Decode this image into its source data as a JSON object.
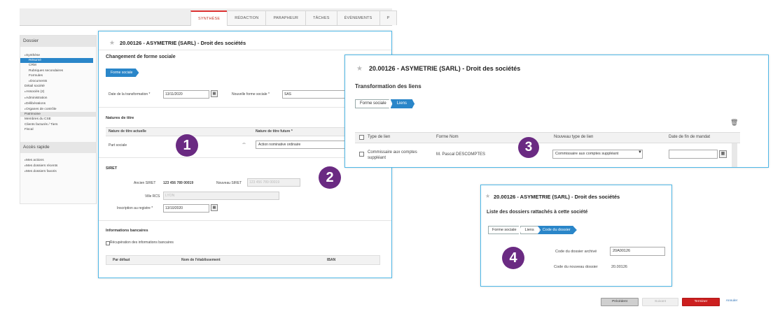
{
  "tabs": [
    "SYNTHÈSE",
    "RÉDACTION",
    "PARAPHEUR",
    "TÂCHES",
    "ÉVÈNEMENTS",
    "P"
  ],
  "sidebar": {
    "dossier_title": "Dossier",
    "items": [
      {
        "label": "Synthèse"
      },
      {
        "label": "Résumé"
      },
      {
        "label": "CRM"
      },
      {
        "label": "Rubriques secondaires"
      },
      {
        "label": "Formules"
      },
      {
        "label": "Documents"
      },
      {
        "label": "Détail société"
      },
      {
        "label": "Associés (2)"
      },
      {
        "label": "Administration"
      },
      {
        "label": "Délibérations"
      },
      {
        "label": "Organes de contrôle"
      },
      {
        "label": "Patrimoine"
      },
      {
        "label": "Membres du CSE"
      },
      {
        "label": "Clients facturés / Tiers"
      },
      {
        "label": "Fiscal"
      }
    ],
    "quick_title": "Accès rapide",
    "quick_items": [
      {
        "label": "Mes actions"
      },
      {
        "label": "Mes dossiers récents"
      },
      {
        "label": "Mes dossiers favoris"
      }
    ]
  },
  "panel1": {
    "title": "20.00126 - ASYMETRIE (SARL) - Droit des sociétés",
    "section1": "Changement de forme sociale",
    "crumb": "Forme sociale",
    "date_label": "Date de la transformation *",
    "date_value": "13/11/2020",
    "new_form_label": "Nouvelle forme sociale *",
    "new_form_value": "SAS",
    "natures_title": "Natures de titre",
    "col_current": "Nature de titre actuelle",
    "col_future": "Nature de titre future *",
    "row_current": "Part sociale",
    "row_future": "Action nominative ordinaire",
    "siret_title": "SIRET",
    "old_siret_label": "Ancien SIRET",
    "old_siret_value": "123 456 789 00019",
    "new_siret_label": "Nouveau SIRET",
    "new_siret_value": "123 456 789 00019",
    "rcs_label": "Ville RCS",
    "rcs_value": "LYON",
    "inscription_label": "Inscription au registre *",
    "inscription_value": "13/10/2020",
    "bank_title": "Informations bancaires",
    "bank_check": "Récupération des informations bancaires",
    "col_default": "Par défaut",
    "col_estab": "Nom de l'établissement",
    "col_iban": "IBAN"
  },
  "panel2": {
    "title": "20.00126 - ASYMETRIE (SARL) - Droit des sociétés",
    "section": "Transformation des liens",
    "crumbs": [
      "Forme sociale",
      "Liens"
    ],
    "col_type": "Type de lien",
    "col_nom": "Forme Nom",
    "col_new_type": "Nouveau type de lien",
    "col_date_end": "Date de fin de mandat",
    "row_type": "Commissaire aux comptes suppléant",
    "row_nom": "M. Pascal DESCOMPTES",
    "row_new_type": "Commissaire aux comptes suppléant"
  },
  "panel3": {
    "title": "20.00126 - ASYMETRIE (SARL) - Droit des sociétés",
    "section": "Liste des dossiers rattachés à cette société",
    "crumbs": [
      "Forme sociale",
      "Liens",
      "Code du dossier"
    ],
    "archived_label": "Code du dossier archivé",
    "archived_value": "20A00126",
    "new_code_label": "Code du nouveau dossier",
    "new_code_value": "20.00126"
  },
  "badges": [
    "1",
    "2",
    "3",
    "4"
  ],
  "footer": {
    "prev": "Précédent",
    "next": "Suivant",
    "finish": "Terminer",
    "cancel": "Annuler"
  },
  "colors": {
    "accent": "#2a86c9",
    "panel_border": "#4fb7e6",
    "badge": "#6a2a82",
    "finish": "#cc1f1f",
    "tab_active": "#c0392b"
  }
}
